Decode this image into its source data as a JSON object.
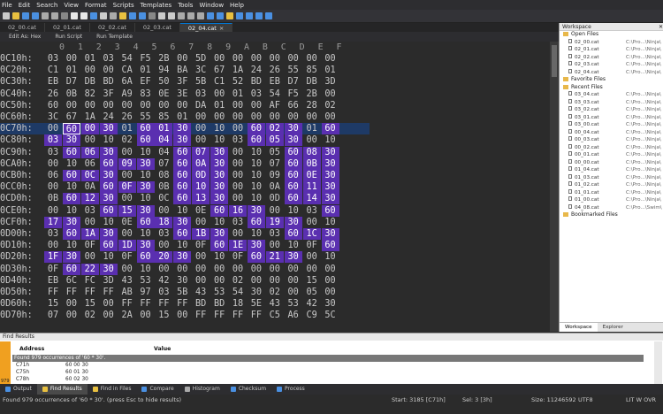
{
  "menu": [
    "File",
    "Edit",
    "Search",
    "View",
    "Format",
    "Scripts",
    "Templates",
    "Tools",
    "Window",
    "Help"
  ],
  "tabs": [
    {
      "label": "02_00.cat",
      "active": false
    },
    {
      "label": "02_01.cat",
      "active": false
    },
    {
      "label": "02_02.cat",
      "active": false
    },
    {
      "label": "02_03.cat",
      "active": false
    },
    {
      "label": "02_04.cat",
      "active": true
    }
  ],
  "subbar": {
    "edit_as": "Edit As: Hex",
    "run_script": "Run Script",
    "run_template": "Run Template"
  },
  "hex_header": [
    "0",
    "1",
    "2",
    "3",
    "4",
    "5",
    "6",
    "7",
    "8",
    "9",
    "A",
    "B",
    "C",
    "D",
    "E",
    "F"
  ],
  "hex_rows": [
    {
      "addr": "0C10h:",
      "bytes": [
        "03",
        "00",
        "01",
        "03",
        "54",
        "F5",
        "2B",
        "00",
        "5D",
        "00",
        "00",
        "00",
        "00",
        "00",
        "00",
        "00"
      ],
      "hl": []
    },
    {
      "addr": "0C20h:",
      "bytes": [
        "C1",
        "01",
        "00",
        "00",
        "CA",
        "01",
        "94",
        "BA",
        "3C",
        "67",
        "1A",
        "24",
        "26",
        "55",
        "85",
        "01"
      ],
      "hl": []
    },
    {
      "addr": "0C30h:",
      "bytes": [
        "EB",
        "D7",
        "DB",
        "BD",
        "6A",
        "EF",
        "50",
        "3F",
        "5B",
        "C1",
        "52",
        "BD",
        "EB",
        "D7",
        "DB",
        "3D"
      ],
      "hl": []
    },
    {
      "addr": "0C40h:",
      "bytes": [
        "26",
        "0B",
        "82",
        "3F",
        "A9",
        "83",
        "0E",
        "3E",
        "03",
        "00",
        "01",
        "03",
        "54",
        "F5",
        "2B",
        "00"
      ],
      "hl": []
    },
    {
      "addr": "0C50h:",
      "bytes": [
        "60",
        "00",
        "00",
        "00",
        "00",
        "00",
        "00",
        "00",
        "DA",
        "01",
        "00",
        "00",
        "AF",
        "66",
        "28",
        "02"
      ],
      "hl": []
    },
    {
      "addr": "0C60h:",
      "bytes": [
        "3C",
        "67",
        "1A",
        "24",
        "26",
        "55",
        "85",
        "01",
        "00",
        "00",
        "00",
        "00",
        "00",
        "00",
        "00",
        "00"
      ],
      "hl": []
    },
    {
      "addr": "0C70h:",
      "bytes": [
        "00",
        "60",
        "00",
        "30",
        "01",
        "60",
        "01",
        "30",
        "00",
        "10",
        "00",
        "60",
        "02",
        "30",
        "01",
        "60"
      ],
      "hl": [
        1,
        2,
        3,
        5,
        6,
        7,
        11,
        12,
        13,
        15
      ],
      "cursor": true
    },
    {
      "addr": "0C80h:",
      "bytes": [
        "03",
        "30",
        "00",
        "10",
        "02",
        "60",
        "04",
        "30",
        "00",
        "10",
        "03",
        "60",
        "05",
        "30",
        "00",
        "10"
      ],
      "hl": [
        0,
        1,
        5,
        6,
        7,
        11,
        12,
        13
      ]
    },
    {
      "addr": "0C90h:",
      "bytes": [
        "03",
        "60",
        "06",
        "30",
        "00",
        "10",
        "04",
        "60",
        "07",
        "30",
        "00",
        "10",
        "05",
        "60",
        "08",
        "30"
      ],
      "hl": [
        1,
        2,
        3,
        7,
        8,
        9,
        13,
        14,
        15
      ]
    },
    {
      "addr": "0CA0h:",
      "bytes": [
        "00",
        "10",
        "06",
        "60",
        "09",
        "30",
        "07",
        "60",
        "0A",
        "30",
        "00",
        "10",
        "07",
        "60",
        "0B",
        "30"
      ],
      "hl": [
        3,
        4,
        5,
        7,
        8,
        9,
        13,
        14,
        15
      ]
    },
    {
      "addr": "0CB0h:",
      "bytes": [
        "06",
        "60",
        "0C",
        "30",
        "00",
        "10",
        "08",
        "60",
        "0D",
        "30",
        "00",
        "10",
        "09",
        "60",
        "0E",
        "30"
      ],
      "hl": [
        1,
        2,
        3,
        7,
        8,
        9,
        13,
        14,
        15
      ]
    },
    {
      "addr": "0CC0h:",
      "bytes": [
        "00",
        "10",
        "0A",
        "60",
        "0F",
        "30",
        "0B",
        "60",
        "10",
        "30",
        "00",
        "10",
        "0A",
        "60",
        "11",
        "30"
      ],
      "hl": [
        3,
        4,
        5,
        7,
        8,
        9,
        13,
        14,
        15
      ]
    },
    {
      "addr": "0CD0h:",
      "bytes": [
        "0B",
        "60",
        "12",
        "30",
        "00",
        "10",
        "0C",
        "60",
        "13",
        "30",
        "00",
        "10",
        "0D",
        "60",
        "14",
        "30"
      ],
      "hl": [
        1,
        2,
        3,
        7,
        8,
        9,
        13,
        14,
        15
      ]
    },
    {
      "addr": "0CE0h:",
      "bytes": [
        "00",
        "10",
        "03",
        "60",
        "15",
        "30",
        "00",
        "10",
        "0E",
        "60",
        "16",
        "30",
        "00",
        "10",
        "03",
        "60"
      ],
      "hl": [
        3,
        4,
        5,
        9,
        10,
        11,
        15
      ]
    },
    {
      "addr": "0CF0h:",
      "bytes": [
        "17",
        "30",
        "00",
        "10",
        "0E",
        "60",
        "18",
        "30",
        "00",
        "10",
        "03",
        "60",
        "19",
        "30",
        "00",
        "10"
      ],
      "hl": [
        0,
        1,
        5,
        6,
        7,
        11,
        12,
        13
      ]
    },
    {
      "addr": "0D00h:",
      "bytes": [
        "03",
        "60",
        "1A",
        "30",
        "00",
        "10",
        "03",
        "60",
        "1B",
        "30",
        "00",
        "10",
        "03",
        "60",
        "1C",
        "30"
      ],
      "hl": [
        1,
        2,
        3,
        7,
        8,
        9,
        13,
        14,
        15
      ]
    },
    {
      "addr": "0D10h:",
      "bytes": [
        "00",
        "10",
        "0F",
        "60",
        "1D",
        "30",
        "00",
        "10",
        "0F",
        "60",
        "1E",
        "30",
        "00",
        "10",
        "0F",
        "60"
      ],
      "hl": [
        3,
        4,
        5,
        9,
        10,
        11,
        15
      ]
    },
    {
      "addr": "0D20h:",
      "bytes": [
        "1F",
        "30",
        "00",
        "10",
        "0F",
        "60",
        "20",
        "30",
        "00",
        "10",
        "0F",
        "60",
        "21",
        "30",
        "00",
        "10"
      ],
      "hl": [
        0,
        1,
        5,
        6,
        7,
        11,
        12,
        13
      ]
    },
    {
      "addr": "0D30h:",
      "bytes": [
        "0F",
        "60",
        "22",
        "30",
        "00",
        "10",
        "00",
        "00",
        "00",
        "00",
        "00",
        "00",
        "00",
        "00",
        "00",
        "00"
      ],
      "hl": [
        1,
        2,
        3
      ]
    },
    {
      "addr": "0D40h:",
      "bytes": [
        "EB",
        "6C",
        "FC",
        "3D",
        "43",
        "53",
        "42",
        "30",
        "00",
        "00",
        "02",
        "00",
        "00",
        "00",
        "15",
        "00"
      ],
      "hl": []
    },
    {
      "addr": "0D50h:",
      "bytes": [
        "FF",
        "FF",
        "FF",
        "FF",
        "AB",
        "97",
        "03",
        "5B",
        "43",
        "53",
        "54",
        "30",
        "02",
        "00",
        "05",
        "00"
      ],
      "hl": []
    },
    {
      "addr": "0D60h:",
      "bytes": [
        "15",
        "00",
        "15",
        "00",
        "FF",
        "FF",
        "FF",
        "FF",
        "BD",
        "BD",
        "18",
        "5E",
        "43",
        "53",
        "42",
        "30"
      ],
      "hl": []
    },
    {
      "addr": "0D70h:",
      "bytes": [
        "07",
        "00",
        "02",
        "00",
        "2A",
        "00",
        "15",
        "00",
        "FF",
        "FF",
        "FF",
        "FF",
        "C5",
        "A6",
        "C9",
        "5C"
      ],
      "hl": []
    }
  ],
  "workspace": {
    "title": "Workspace",
    "open_files_label": "Open Files",
    "open_files": [
      {
        "name": "02_00.cat",
        "path": "C:\\Pro...\\Ninja\\"
      },
      {
        "name": "02_01.cat",
        "path": "C:\\Pro...\\Ninja\\"
      },
      {
        "name": "02_02.cat",
        "path": "C:\\Pro...\\Ninja\\"
      },
      {
        "name": "02_03.cat",
        "path": "C:\\Pro...\\Ninja\\"
      },
      {
        "name": "02_04.cat",
        "path": "C:\\Pro...\\Ninja\\"
      }
    ],
    "favorite_files_label": "Favorite Files",
    "recent_files_label": "Recent Files",
    "recent_files": [
      {
        "name": "03_04.cat",
        "path": "C:\\Pro...\\Ninja\\"
      },
      {
        "name": "03_03.cat",
        "path": "C:\\Pro...\\Ninja\\"
      },
      {
        "name": "03_02.cat",
        "path": "C:\\Pro...\\Ninja\\"
      },
      {
        "name": "03_01.cat",
        "path": "C:\\Pro...\\Ninja\\"
      },
      {
        "name": "03_00.cat",
        "path": "C:\\Pro...\\Ninja\\"
      },
      {
        "name": "00_04.cat",
        "path": "C:\\Pro...\\Ninja\\"
      },
      {
        "name": "00_03.cat",
        "path": "C:\\Pro...\\Ninja\\"
      },
      {
        "name": "00_02.cat",
        "path": "C:\\Pro...\\Ninja\\"
      },
      {
        "name": "00_01.cat",
        "path": "C:\\Pro...\\Ninja\\"
      },
      {
        "name": "00_00.cat",
        "path": "C:\\Pro...\\Ninja\\"
      },
      {
        "name": "01_04.cat",
        "path": "C:\\Pro...\\Ninja\\"
      },
      {
        "name": "01_03.cat",
        "path": "C:\\Pro...\\Ninja\\"
      },
      {
        "name": "01_02.cat",
        "path": "C:\\Pro...\\Ninja\\"
      },
      {
        "name": "01_01.cat",
        "path": "C:\\Pro...\\Ninja\\"
      },
      {
        "name": "01_00.cat",
        "path": "C:\\Pro...\\Ninja\\"
      },
      {
        "name": "04_08.cat",
        "path": "C:\\Pro...\\Swim\\"
      }
    ],
    "bookmarked_files_label": "Bookmarked Files",
    "footer_tabs": [
      "Workspace",
      "Explorer"
    ]
  },
  "find_results": {
    "title": "Find Results",
    "col_address": "Address",
    "col_value": "Value",
    "summary": "Found 979 occurrences of '60 * 30'.",
    "rows": [
      {
        "address": "C71h",
        "value": "60 00 30"
      },
      {
        "address": "C75h",
        "value": "60 01 30"
      },
      {
        "address": "C78h",
        "value": "60 02 30"
      }
    ],
    "side_label": "979"
  },
  "bottom_tabs": [
    "Output",
    "Find Results",
    "Find in Files",
    "Compare",
    "Histogram",
    "Checksum",
    "Process"
  ],
  "status": {
    "message": "Found 979 occurrences of '60 * 30'. (press Esc to hide results)",
    "start": "Start: 3185 [C71h]",
    "sel": "Sel: 3 [3h]",
    "size": "Size: 11246592",
    "encoding": "UTF8",
    "flags": "LIT  W  OVR"
  },
  "colors": {
    "highlight": "#5a2fb0",
    "cursor_row": "#1e3a66",
    "accent": "#0078d7"
  }
}
